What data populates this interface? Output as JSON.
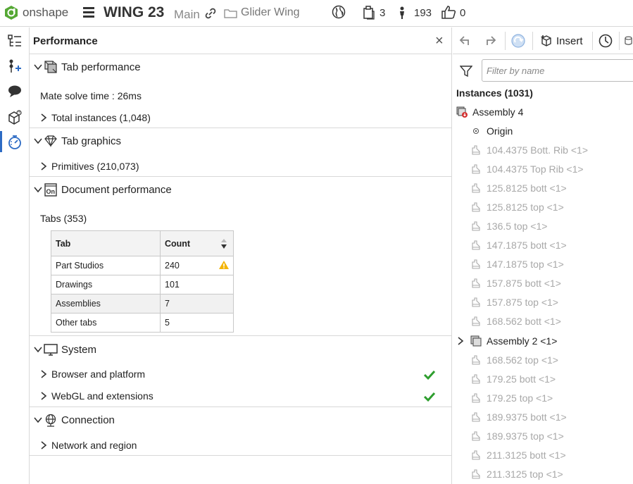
{
  "app": {
    "brand": "onshape",
    "document_title": "WING 23",
    "branch": "Main",
    "folder": "Glider Wing",
    "versions_count": "3",
    "followers_count": "193",
    "likes_count": "0"
  },
  "panel": {
    "title": "Performance",
    "close_glyph": "×",
    "tab_performance": {
      "header": "Tab performance",
      "mate_solve": "Mate solve time : 26ms",
      "total_instances": "Total instances (1,048)"
    },
    "tab_graphics": {
      "header": "Tab graphics",
      "primitives": "Primitives (210,073)"
    },
    "document_performance": {
      "header": "Document performance",
      "tabs_label": "Tabs (353)",
      "table": {
        "col_tab": "Tab",
        "col_count": "Count",
        "rows": [
          {
            "tab": "Part Studios",
            "count": "240",
            "warning": true
          },
          {
            "tab": "Drawings",
            "count": "101"
          },
          {
            "tab": "Assemblies",
            "count": "7"
          },
          {
            "tab": "Other tabs",
            "count": "5"
          }
        ]
      }
    },
    "system": {
      "header": "System",
      "browser": "Browser and platform",
      "webgl": "WebGL and extensions"
    },
    "connection": {
      "header": "Connection",
      "network": "Network and region"
    }
  },
  "right_panel": {
    "insert_label": "Insert",
    "filter_placeholder": "Filter by name",
    "instances_heading": "Instances (1031)",
    "tree": [
      {
        "label": "Assembly 4",
        "kind": "root-assembly"
      },
      {
        "label": "Origin",
        "kind": "origin"
      },
      {
        "label": "104.4375 Bott. Rib <1>",
        "kind": "part"
      },
      {
        "label": "104.4375 Top Rib <1>",
        "kind": "part"
      },
      {
        "label": "125.8125 bott <1>",
        "kind": "part"
      },
      {
        "label": "125.8125 top <1>",
        "kind": "part"
      },
      {
        "label": "136.5 top <1>",
        "kind": "part"
      },
      {
        "label": "147.1875 bott <1>",
        "kind": "part"
      },
      {
        "label": "147.1875 top <1>",
        "kind": "part"
      },
      {
        "label": "157.875 bott <1>",
        "kind": "part"
      },
      {
        "label": "157.875 top <1>",
        "kind": "part"
      },
      {
        "label": "168.562 bott <1>",
        "kind": "part"
      },
      {
        "label": "Assembly 2 <1>",
        "kind": "subassembly"
      },
      {
        "label": "168.562 top <1>",
        "kind": "part"
      },
      {
        "label": "179.25 bott <1>",
        "kind": "part"
      },
      {
        "label": "179.25 top <1>",
        "kind": "part"
      },
      {
        "label": "189.9375 bott <1>",
        "kind": "part"
      },
      {
        "label": "189.9375 top <1>",
        "kind": "part"
      },
      {
        "label": "211.3125 bott <1>",
        "kind": "part"
      },
      {
        "label": "211.3125 top <1>",
        "kind": "part"
      }
    ]
  },
  "colors": {
    "accent": "#2d6bc4",
    "logo_green": "#55a834",
    "check_green": "#2e9e2e",
    "warning_yellow": "#f4b400",
    "error_red": "#d32f2f"
  },
  "icons": {
    "rail": [
      "feature-list-icon",
      "variables-icon",
      "comments-icon",
      "app-store-icon",
      "performance-icon"
    ],
    "toolbar": [
      "undo-icon",
      "redo-icon",
      "sync-icon",
      "insert-icon",
      "history-icon",
      "parts-icon"
    ]
  }
}
